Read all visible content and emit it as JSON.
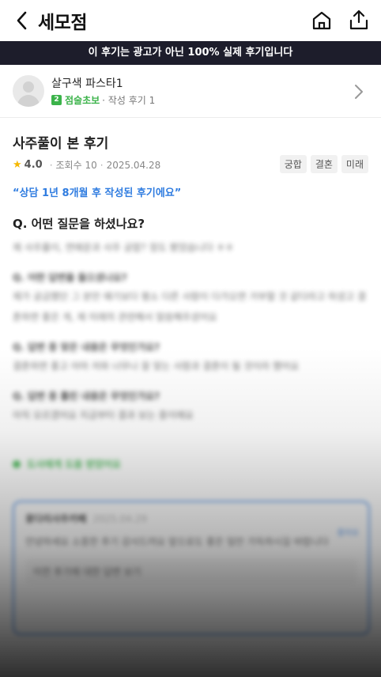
{
  "header": {
    "title": "세모점"
  },
  "banner": {
    "prefix": "이 후기는 광고가 아닌 ",
    "highlight": "100% 실제 후기입니다"
  },
  "author": {
    "name": "살구색 파스타1",
    "level_number": "2",
    "level_name": "점술초보",
    "review_count_label": "· 작성 후기 1"
  },
  "review": {
    "title": "사주풀이 본 후기",
    "rating": "4.0",
    "views_label": "조회수 10",
    "date": "2025.04.28",
    "tags": [
      "궁합",
      "결혼",
      "미래"
    ],
    "quote": "“상담 1년 8개월 후 작성된 후기에요”",
    "question1": "Q. 어떤 질문을 하셨나요?"
  },
  "blurred": {
    "answer1": "제 사주풀이, 연애운과 사주 궁합? 정도 봤었습니다 ㅎㅎ",
    "question2": "Q. 어떤 답변을 들으셨나요?",
    "answer2": "제가 궁금했던 그 분만 얘기보다 평소 다른 사람이 다가오면 거부할 것 같다라고 하셨고 결혼하면 좋은 게, 제 미래의 관련해서 말씀해주셨어요",
    "question3": "Q. 답변 중 맞은 내용은 무엇인가요?",
    "answer3": "결혼하면 좋고 아마 저와 너무나 잘 맞는 사람과 결혼이 될 것이라 했어요",
    "question4": "Q. 답변 중 틀린 내용은 무엇인가요?",
    "answer4": "아직 모르겠어요 지금부터 결과 보는 중이에요",
    "green_note": "도사에게 도움 받았어요",
    "card_name": "꽃다리사주카페",
    "card_sub": "2025.04.29",
    "card_text": "안녕하세요 소중한 후기 감사드려요 앞으로도 좋은 일만 가득하시길 바랍니다",
    "card_inner": "이전 후기에 대한 답변 보기",
    "card_like": "좋아요"
  }
}
